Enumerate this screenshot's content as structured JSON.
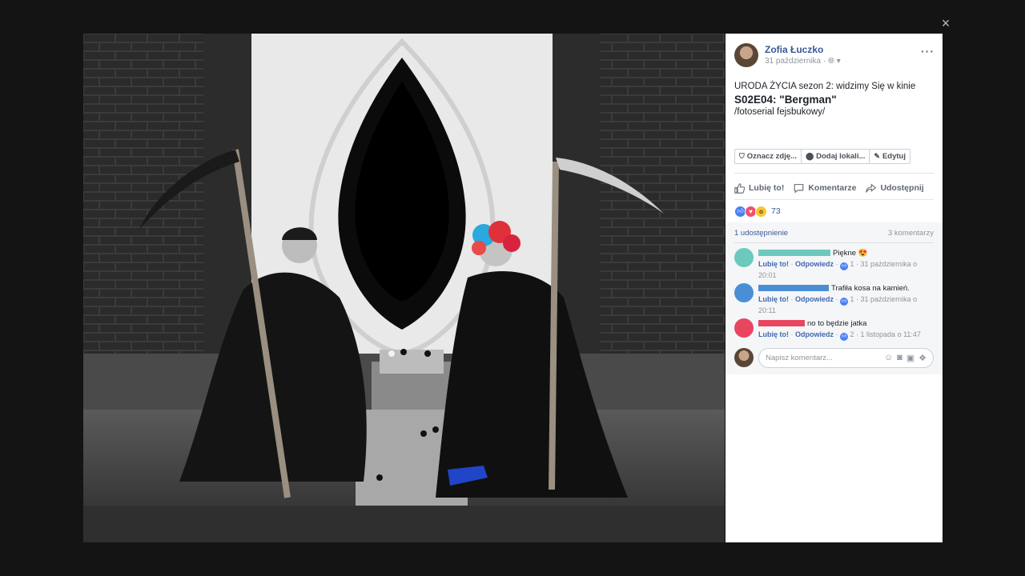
{
  "viewer": {
    "close_label": "×"
  },
  "post": {
    "author": "Zofia Łuczko",
    "date": "31 października · ",
    "privacy_icon": "globe-icon",
    "text_line1": "URODA ŻYCIA sezon 2: widzimy Się w kinie",
    "text_line2": "S02E04: \"Bergman\"",
    "text_line3": "/fotoserial fejsbukowy/"
  },
  "photo_tools": [
    {
      "label": "Oznacz zdję...",
      "icon": "tag-icon"
    },
    {
      "label": "Dodaj lokali...",
      "icon": "location-pin-icon"
    },
    {
      "label": "Edytuj",
      "icon": "pencil-icon"
    }
  ],
  "actions": {
    "like": "Lubię to!",
    "comment": "Komentarze",
    "share": "Udostępnij"
  },
  "reactions": {
    "count": "73"
  },
  "stats": {
    "shares": "1 udostępnienie",
    "comments": "3 komentarzy"
  },
  "comments": [
    {
      "text": "Piękne 😍",
      "like": "Lubię to!",
      "reply": "Odpowiedz",
      "likes": "1",
      "time": "31 października o 20:01",
      "avatar_color": "#6cc9bd",
      "bar_color": "#6cc9bd"
    },
    {
      "text": "Trafiła kosa na kamień.",
      "like": "Lubię to!",
      "reply": "Odpowiedz",
      "likes": "1",
      "time": "31 października o 20:11",
      "avatar_color": "#4a8fd6",
      "bar_color": "#4a8fd6"
    },
    {
      "text": "no to będzie jatka",
      "like": "Lubię to!",
      "reply": "Odpowiedz",
      "likes": "2",
      "time": "1 listopada o 11:47",
      "avatar_color": "#e8465f",
      "bar_color": "#e8465f"
    }
  ],
  "composer": {
    "placeholder": "Napisz komentarz..."
  }
}
